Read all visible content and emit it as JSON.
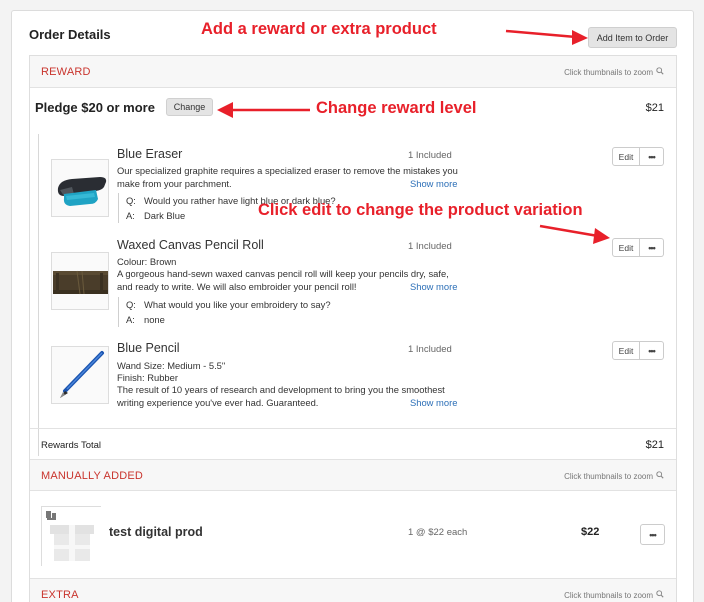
{
  "order": {
    "title": "Order Details",
    "add_item_label": "Add Item to Order"
  },
  "reward_section": {
    "label": "REWARD",
    "zoom_hint": "Click thumbnails to zoom",
    "pledge_title": "Pledge $20 or more",
    "change_label": "Change",
    "pledge_price": "$21",
    "items": [
      {
        "name": "Blue Eraser",
        "included": "1 Included",
        "edit_label": "Edit",
        "more_label": "•••",
        "details": [],
        "description": "Our specialized graphite requires a specialized eraser to remove the mistakes you make from your parchment.",
        "show_more": "Show more",
        "qa": {
          "q_key": "Q:",
          "q": "Would you rather have light blue or dark blue?",
          "a_key": "A:",
          "a": "Dark Blue"
        },
        "thumb_icon": "eraser-image"
      },
      {
        "name": "Waxed Canvas Pencil Roll",
        "included": "1 Included",
        "edit_label": "Edit",
        "more_label": "•••",
        "details": [
          "Colour: Brown"
        ],
        "description": "A gorgeous hand-sewn waxed canvas pencil roll will keep your pencils dry, safe, and ready to write. We will also embroider your pencil roll!",
        "show_more": "Show more",
        "qa": {
          "q_key": "Q:",
          "q": "What would you like your embroidery to say?",
          "a_key": "A:",
          "a": "none"
        },
        "thumb_icon": "pencil-roll-image"
      },
      {
        "name": "Blue Pencil",
        "included": "1 Included",
        "edit_label": "Edit",
        "more_label": "•••",
        "details": [
          "Wand Size: Medium - 5.5\"",
          "Finish: Rubber"
        ],
        "description": "The result of 10 years of research and development to bring you the smoothest writing experience you've ever had. Guaranteed.",
        "show_more": "Show more",
        "thumb_icon": "pencil-image"
      }
    ],
    "totals_label": "Rewards Total",
    "totals_value": "$21"
  },
  "manual_section": {
    "label": "MANUALLY ADDED",
    "zoom_hint": "Click thumbnails to zoom",
    "item": {
      "name": "test digital prod",
      "qty": "1 @ $22 each",
      "price": "$22",
      "more_label": "•••"
    }
  },
  "extra_section": {
    "label": "EXTRA",
    "zoom_hint": "Click thumbnails to zoom"
  },
  "annotations": {
    "add": "Add a reward or extra product",
    "change": "Change reward level",
    "edit": "Click edit to change the product variation",
    "color": "#e8202a"
  }
}
